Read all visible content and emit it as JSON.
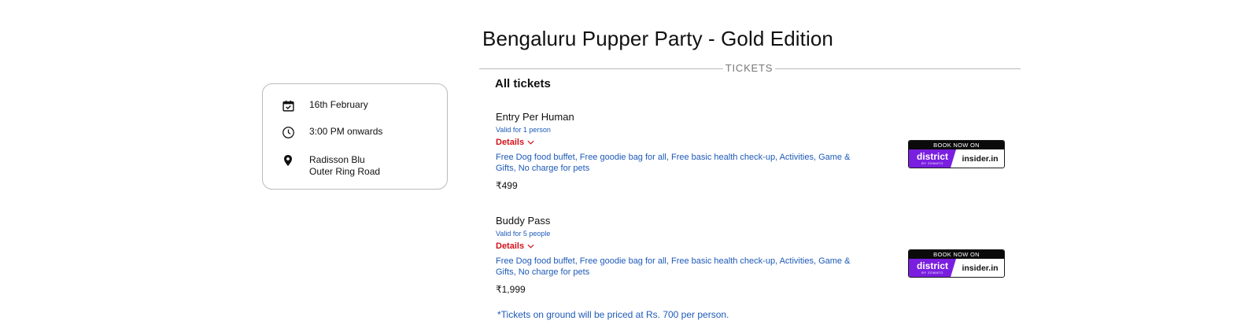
{
  "event": {
    "title": "Bengaluru Pupper Party - Gold Edition",
    "section_label": "TICKETS"
  },
  "info": {
    "date": "16th February",
    "time": "3:00 PM onwards",
    "venue_line1": "Radisson Blu",
    "venue_line2": "Outer Ring Road",
    "icons": [
      "calendar-check-icon",
      "clock-icon",
      "location-pin-icon"
    ]
  },
  "tickets": {
    "heading": "All tickets",
    "items": [
      {
        "name": "Entry Per Human",
        "valid": "Valid for 1 person",
        "details_label": "Details",
        "description": "Free Dog food buffet, Free goodie bag for all, Free basic health check-up, Activities, Game & Gifts, No charge for pets",
        "price": "₹499"
      },
      {
        "name": "Buddy Pass",
        "valid": "Valid for 5 people",
        "details_label": "Details",
        "description": "Free Dog food buffet, Free goodie bag for all, Free basic health check-up, Activities, Game & Gifts, No charge for pets",
        "price": "₹1,999"
      }
    ],
    "footnote": "*Tickets on ground will be priced at Rs. 700 per person."
  },
  "book_badge": {
    "top_text": "BOOK NOW ON",
    "district_text": "district",
    "district_sub": "BY ZOMATO",
    "insider_text": "insider.in"
  },
  "colors": {
    "link_blue": "#1d5ab8",
    "details_red": "#d0121b",
    "district_purple": "#7a1fe0"
  }
}
